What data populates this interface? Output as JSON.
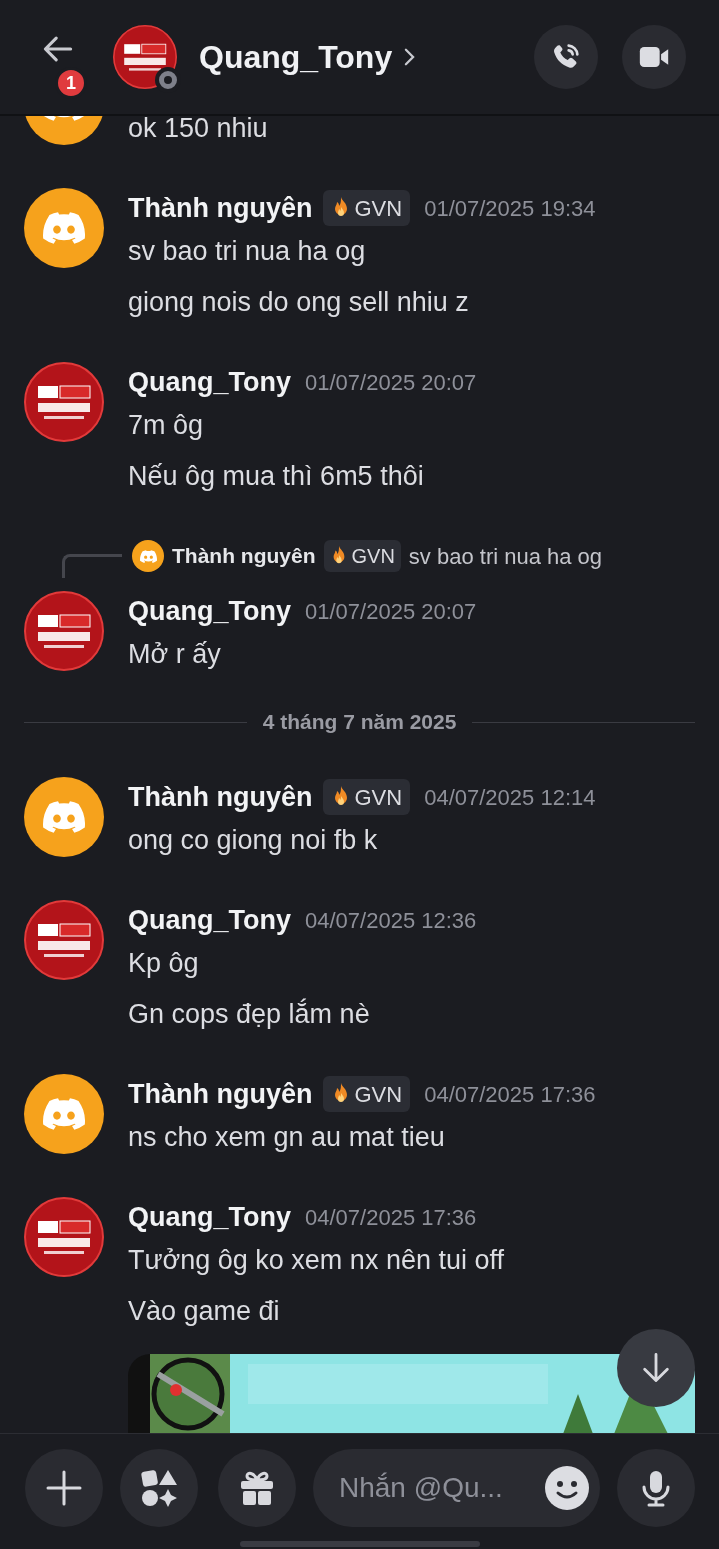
{
  "header": {
    "title": "Quang_Tony",
    "unread_badge": "1"
  },
  "messages": [
    {
      "kind": "continued",
      "avatar": {
        "kind": "discord"
      },
      "lines": [
        "ok 150 nhiu"
      ]
    },
    {
      "kind": "message",
      "avatar": {
        "kind": "discord"
      },
      "author": "Thành nguyên",
      "tag": "GVN",
      "timestamp": "01/07/2025 19:34",
      "lines": [
        "sv bao tri nua ha og",
        "giong nois do ong sell nhiu z"
      ]
    },
    {
      "kind": "message",
      "avatar": {
        "kind": "news"
      },
      "author": "Quang_Tony",
      "timestamp": "01/07/2025 20:07",
      "lines": [
        "7m ôg",
        "Nếu ôg mua thì 6m5 thôi"
      ]
    },
    {
      "kind": "message",
      "avatar": {
        "kind": "news"
      },
      "author": "Quang_Tony",
      "timestamp": "01/07/2025 20:07",
      "reply": {
        "avatar": {
          "kind": "discord"
        },
        "author": "Thành nguyên",
        "tag": "GVN",
        "text": "sv bao tri nua ha og"
      },
      "lines": [
        "Mở r ấy"
      ]
    },
    {
      "kind": "divider",
      "text": "4 tháng 7 năm 2025"
    },
    {
      "kind": "message",
      "avatar": {
        "kind": "discord"
      },
      "author": "Thành nguyên",
      "tag": "GVN",
      "timestamp": "04/07/2025 12:14",
      "lines": [
        "ong co giong noi fb k"
      ]
    },
    {
      "kind": "message",
      "avatar": {
        "kind": "news"
      },
      "author": "Quang_Tony",
      "timestamp": "04/07/2025 12:36",
      "lines": [
        "Kp ôg",
        "Gn cops đẹp lắm nè"
      ]
    },
    {
      "kind": "message",
      "avatar": {
        "kind": "discord"
      },
      "author": "Thành nguyên",
      "tag": "GVN",
      "timestamp": "04/07/2025 17:36",
      "lines": [
        "ns cho xem gn au mat tieu"
      ]
    },
    {
      "kind": "message",
      "avatar": {
        "kind": "news"
      },
      "author": "Quang_Tony",
      "timestamp": "04/07/2025 17:36",
      "lines": [
        "Tưởng ôg ko xem nx nên tui off",
        "Vào game đi"
      ]
    }
  ],
  "composer": {
    "placeholder": "Nhắn @Qu..."
  }
}
